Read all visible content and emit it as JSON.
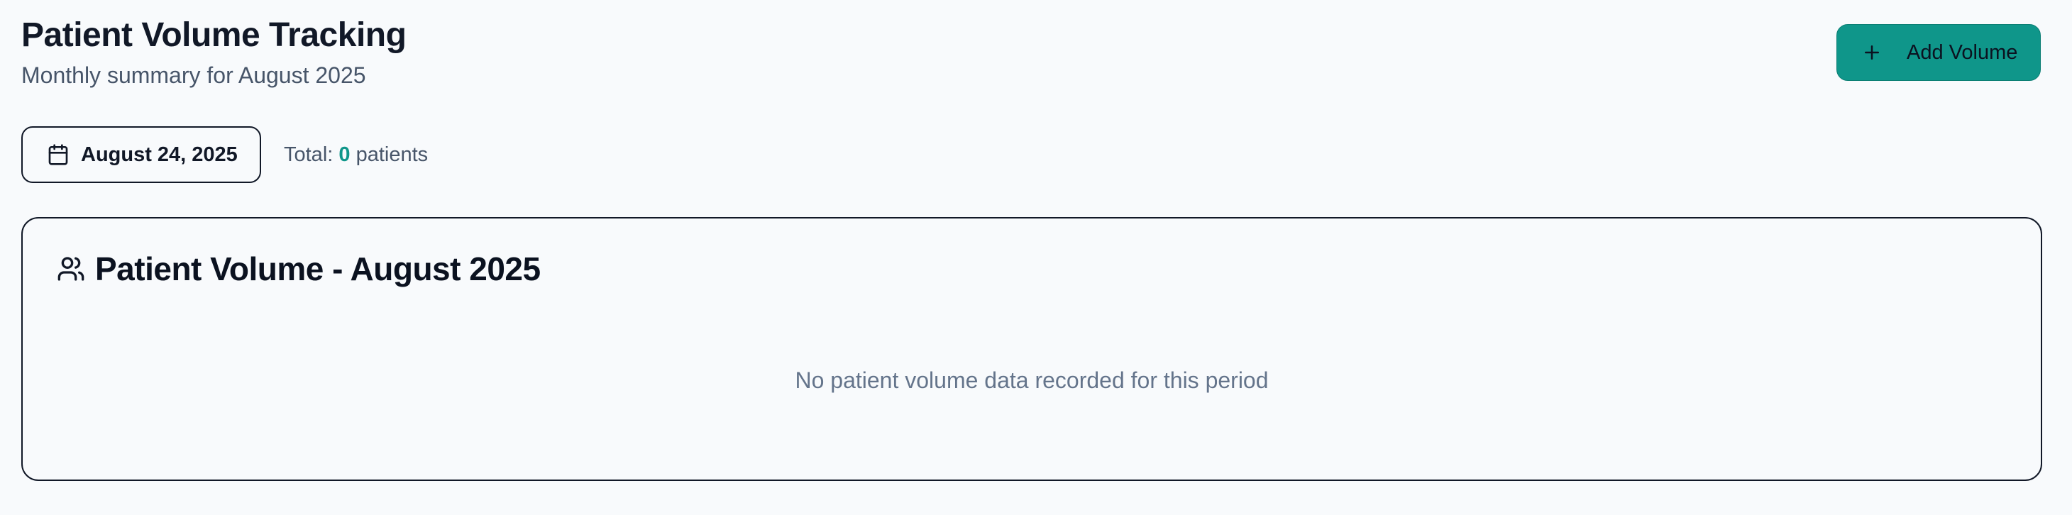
{
  "header": {
    "title": "Patient Volume Tracking",
    "subtitle": "Monthly summary for August 2025"
  },
  "actions": {
    "add_volume_label": "Add Volume",
    "add_icon": "plus-icon"
  },
  "filters": {
    "date_label": "August 24, 2025",
    "date_icon": "calendar-icon"
  },
  "summary": {
    "total_prefix": "Total:",
    "total_count": "0",
    "total_suffix": "patients"
  },
  "card": {
    "icon": "users-icon",
    "title": "Patient Volume - August 2025",
    "empty_message": "No patient volume data recorded for this period"
  },
  "colors": {
    "accent": "#0f968a",
    "background": "#f8fafc",
    "text_primary": "#111827",
    "text_muted": "#64748b"
  }
}
